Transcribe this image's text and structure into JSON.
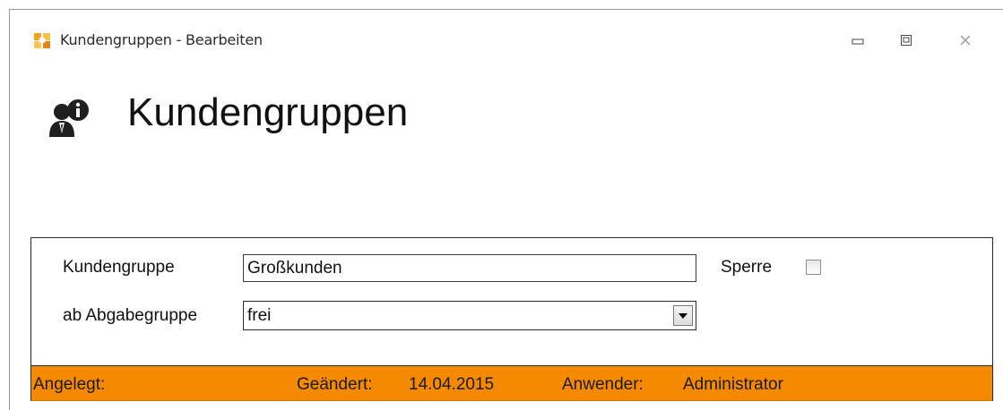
{
  "window": {
    "title": "Kundengruppen - Bearbeiten",
    "controls": [
      "minimize",
      "maximize",
      "close"
    ]
  },
  "header": {
    "title": "Kundengruppen",
    "icon": "customer-group-info-icon"
  },
  "form": {
    "kundengruppe": {
      "label": "Kundengruppe",
      "value": "Großkunden"
    },
    "sperre": {
      "label": "Sperre",
      "checked": false
    },
    "abgabegruppe": {
      "label": "ab Abgabegruppe",
      "value": "frei"
    }
  },
  "status": {
    "angelegt_label": "Angelegt:",
    "geaendert_label": "Geändert:",
    "geaendert_value": "14.04.2015",
    "anwender_label": "Anwender:",
    "anwender_value": "Administrator"
  },
  "colors": {
    "statusbar": "#f58a00",
    "window_bg": "#ffffff"
  }
}
